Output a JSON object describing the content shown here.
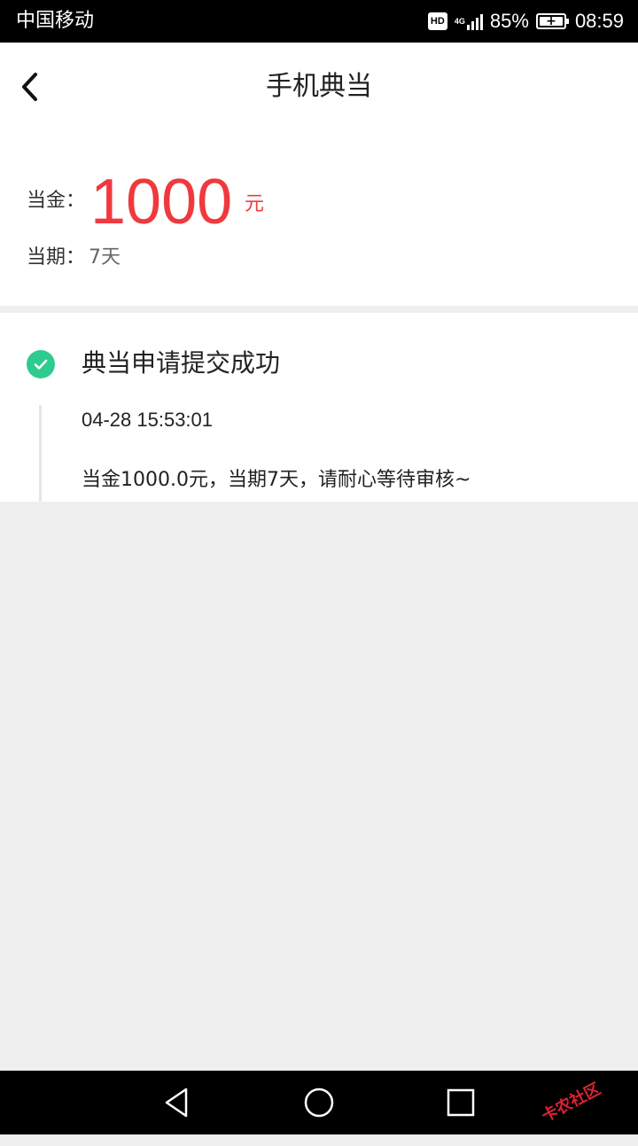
{
  "status_bar": {
    "carrier": "中国移动",
    "hd": "HD",
    "network": "4G",
    "battery_percent": "85%",
    "time": "08:59"
  },
  "header": {
    "title": "手机典当",
    "back_icon": "chevron-left-icon"
  },
  "amount": {
    "label": "当金：",
    "value": "1000",
    "unit": "元",
    "period_label": "当期：",
    "period_value": "7天",
    "accent_color": "#f0393e"
  },
  "timeline": {
    "status_icon": "check-circle-icon",
    "status_color": "#2ecb8f",
    "status": "典当申请提交成功",
    "time": "04-28 15:53:01",
    "description": "当金1000.0元，当期7天，请耐心等待审核~"
  },
  "nav_bar": {
    "buttons": [
      "back-triangle-icon",
      "home-circle-icon",
      "recents-square-icon"
    ],
    "watermark": "卡农社区"
  }
}
